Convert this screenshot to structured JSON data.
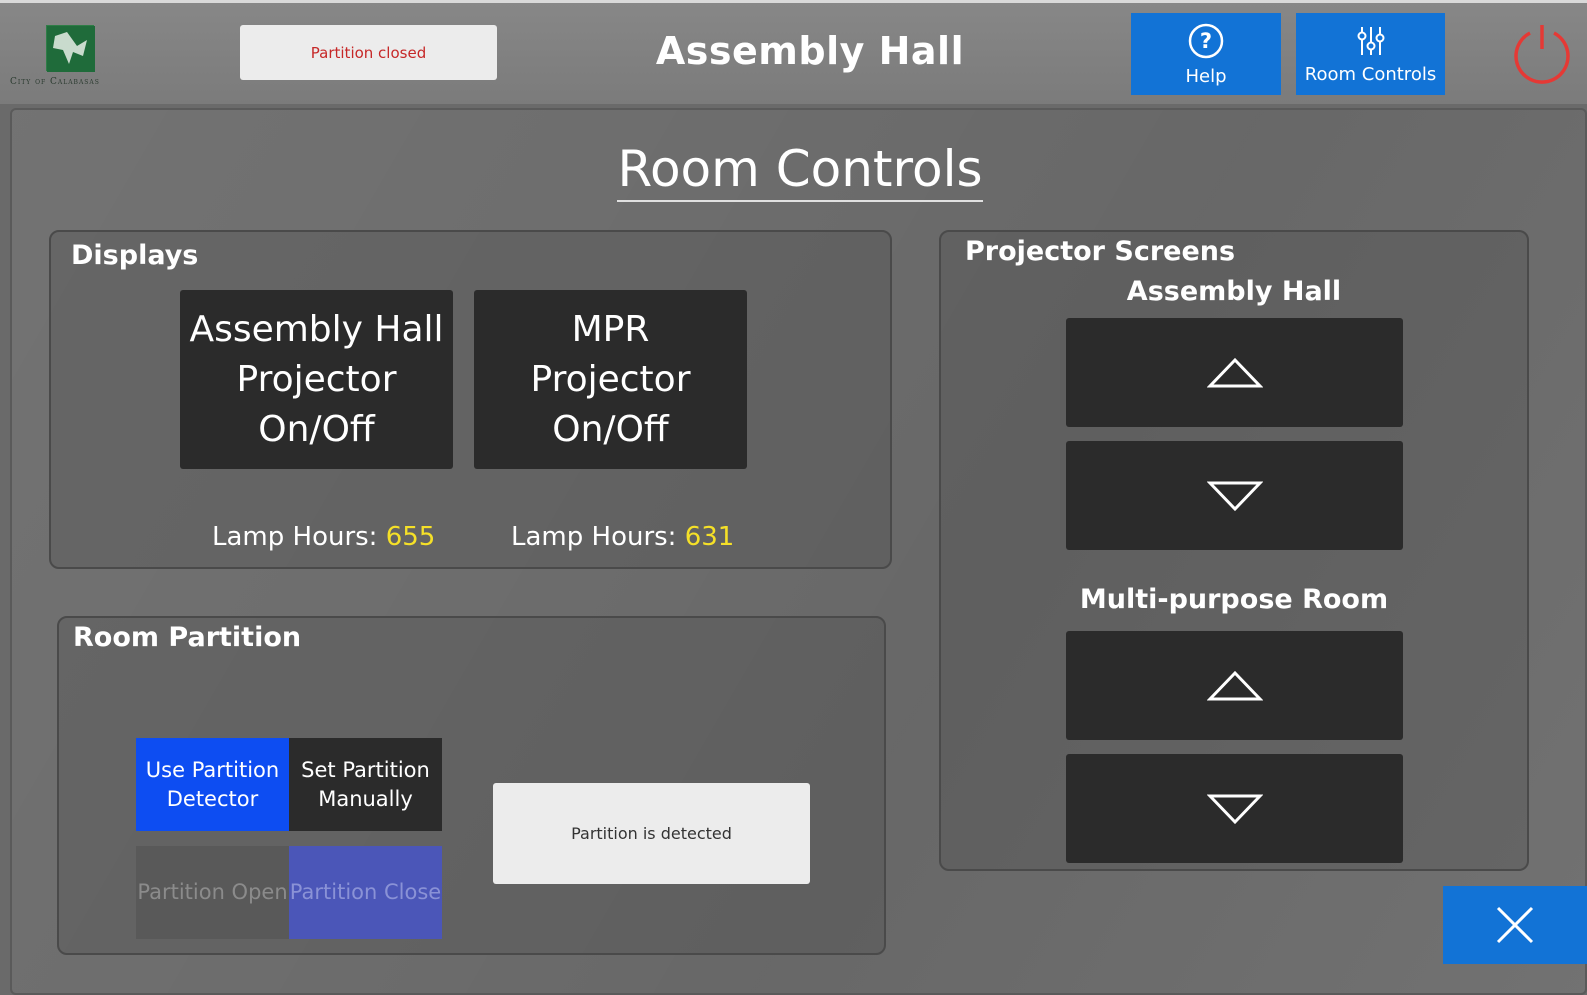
{
  "header": {
    "logo_text": "City of Calabasas",
    "partition_status": "Partition closed",
    "title": "Assembly Hall",
    "help_label": "Help",
    "room_controls_label": "Room Controls",
    "help_icon": "question-circle-icon",
    "room_controls_icon": "sliders-icon",
    "power_icon": "power-icon"
  },
  "page": {
    "title": "Room Controls"
  },
  "displays": {
    "title": "Displays",
    "projectors": [
      {
        "line1": "Assembly Hall",
        "line2": "Projector",
        "line3": "On/Off",
        "lamp_label": "Lamp Hours:",
        "lamp_hours": "655"
      },
      {
        "line1": "MPR",
        "line2": "Projector",
        "line3": "On/Off",
        "lamp_label": "Lamp Hours:",
        "lamp_hours": "631"
      }
    ]
  },
  "partition": {
    "title": "Room Partition",
    "use_detector_line1": "Use Partition",
    "use_detector_line2": "Detector",
    "set_manually_line1": "Set Partition",
    "set_manually_line2": "Manually",
    "open_label": "Partition Open",
    "close_label": "Partition Close",
    "detect_status": "Partition is detected"
  },
  "screens": {
    "title": "Projector Screens",
    "rooms": [
      {
        "name": "Assembly Hall",
        "up_icon": "triangle-up-icon",
        "down_icon": "triangle-down-icon"
      },
      {
        "name": "Multi-purpose Room",
        "up_icon": "triangle-up-icon",
        "down_icon": "triangle-down-icon"
      }
    ]
  },
  "close_icon": "close-x-icon",
  "colors": {
    "accent_blue": "#1273d6",
    "selected_blue": "#0d4df2",
    "lamp_hours_yellow": "#f5e028",
    "status_red": "#c62828",
    "power_red": "#e53935"
  }
}
